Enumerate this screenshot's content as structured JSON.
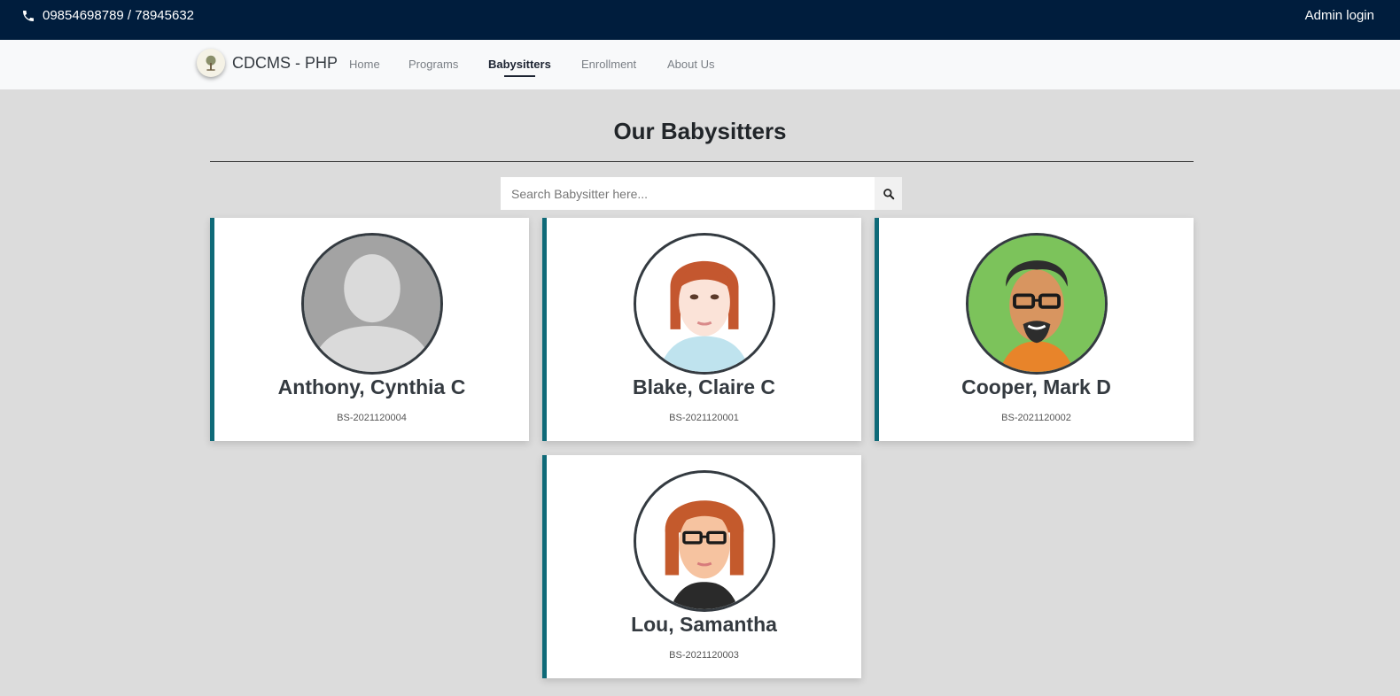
{
  "topbar": {
    "phone": "09854698789 / 78945632",
    "admin_login": "Admin login"
  },
  "navbar": {
    "brand": "CDCMS - PHP",
    "links": [
      "Home",
      "Programs",
      "Babysitters",
      "Enrollment",
      "About Us"
    ],
    "active": "Babysitters"
  },
  "page": {
    "title": "Our Babysitters"
  },
  "search": {
    "placeholder": "Search Babysitter here..."
  },
  "babysitters": [
    {
      "name": "Anthony, Cynthia C",
      "code": "BS-2021120004",
      "avatar": "default-silhouette"
    },
    {
      "name": "Blake, Claire C",
      "code": "BS-2021120001",
      "avatar": "red-hair-woman"
    },
    {
      "name": "Cooper, Mark D",
      "code": "BS-2021120002",
      "avatar": "man-glasses-beard"
    },
    {
      "name": "Lou, Samantha",
      "code": "BS-2021120003",
      "avatar": "woman-glasses"
    }
  ],
  "colors": {
    "topbar": "#001d3d",
    "accent": "#0f6a78",
    "background": "#dcdcdc"
  }
}
